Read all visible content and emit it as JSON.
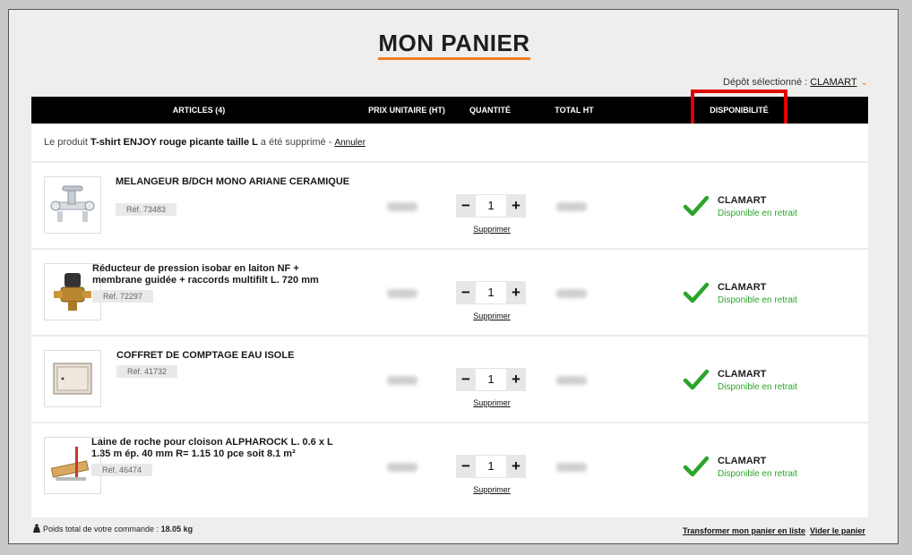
{
  "page": {
    "title": "MON PANIER"
  },
  "depot": {
    "label": "Dépôt sélectionné :",
    "name": "CLAMART"
  },
  "table": {
    "headers": {
      "articles": "ARTICLES (4)",
      "prix": "PRIX UNITAIRE (HT)",
      "quantite": "QUANTITÉ",
      "total": "TOTAL HT",
      "dispo": "DISPONIBILITÉ"
    }
  },
  "notice": {
    "prefix": "Le produit",
    "product": "T-shirt ENJOY rouge picante taille L",
    "suffix": "a été supprimé -",
    "undo": "Annuler"
  },
  "items": [
    {
      "name": "MELANGEUR B/DCH MONO ARIANE CERAMIQUE",
      "ref": "Réf. 73483",
      "qty": "1",
      "delete": "Supprimer",
      "store": "CLAMART",
      "status": "Disponible en retrait"
    },
    {
      "name": "Réducteur de pression isobar en laiton NF + membrane guidée + raccords multifilt L. 720 mm",
      "ref": "Réf. 72297",
      "qty": "1",
      "delete": "Supprimer",
      "store": "CLAMART",
      "status": "Disponible en retrait"
    },
    {
      "name": "COFFRET DE COMPTAGE EAU ISOLE",
      "ref": "Réf. 41732",
      "qty": "1",
      "delete": "Supprimer",
      "store": "CLAMART",
      "status": "Disponible en retrait"
    },
    {
      "name": "Laine de roche pour cloison ALPHAROCK L. 0.6 x L 1.35 m ép. 40 mm R= 1.15 10 pce soit 8.1 m²",
      "ref": "Réf. 46474",
      "qty": "1",
      "delete": "Supprimer",
      "store": "CLAMART",
      "status": "Disponible en retrait"
    }
  ],
  "footer": {
    "weight_label": "Poids total de votre commande :",
    "weight_value": "18.05 kg",
    "to_list": "Transformer mon panier en liste",
    "empty_cart": "Vider le panier"
  },
  "colors": {
    "accent": "#f07c1d",
    "available": "#2aa52a",
    "highlight": "#e00000",
    "header_bg": "#000000"
  },
  "icons": {
    "chevron": "chevron-down-icon",
    "check": "check-icon",
    "weight": "weight-icon",
    "minus": "minus-icon",
    "plus": "plus-icon"
  }
}
